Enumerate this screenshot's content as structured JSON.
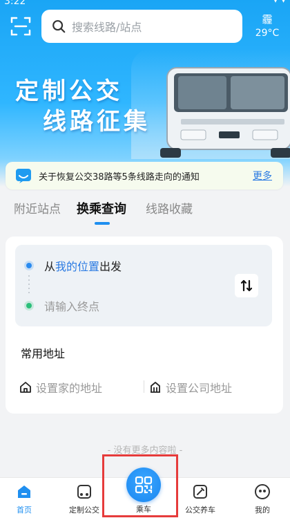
{
  "status_bar": {
    "time": "3:22"
  },
  "header": {
    "search_placeholder": "搜索线路/站点",
    "weather": {
      "condition": "霾",
      "temperature": "29°C"
    }
  },
  "banner": {
    "line1": "定制公交",
    "line2": "线路征集"
  },
  "notice": {
    "text": "关于恢复公交38路等5条线路走向的通知",
    "more": "更多"
  },
  "tabs": [
    {
      "label": "附近站点",
      "active": false
    },
    {
      "label": "换乘查询",
      "active": true
    },
    {
      "label": "线路收藏",
      "active": false
    }
  ],
  "transfer": {
    "from_prefix": "从",
    "from_location": "我的位置",
    "from_suffix": "出发",
    "to_placeholder": "请输入终点"
  },
  "common_addresses": {
    "title": "常用地址",
    "home": "设置家的地址",
    "work": "设置公司地址"
  },
  "footer_note": "- 没有更多内容啦 -",
  "tabbar": [
    {
      "label": "首页",
      "icon": "home-icon",
      "active": true
    },
    {
      "label": "定制公交",
      "icon": "bus-icon",
      "active": false
    },
    {
      "label": "乘车",
      "icon": "qr-code-icon",
      "active": false
    },
    {
      "label": "公交养车",
      "icon": "wrench-icon",
      "active": false
    },
    {
      "label": "我的",
      "icon": "profile-icon",
      "active": false
    }
  ],
  "colors": {
    "accent": "#1f8ff0",
    "highlight": "#e63b3b"
  }
}
